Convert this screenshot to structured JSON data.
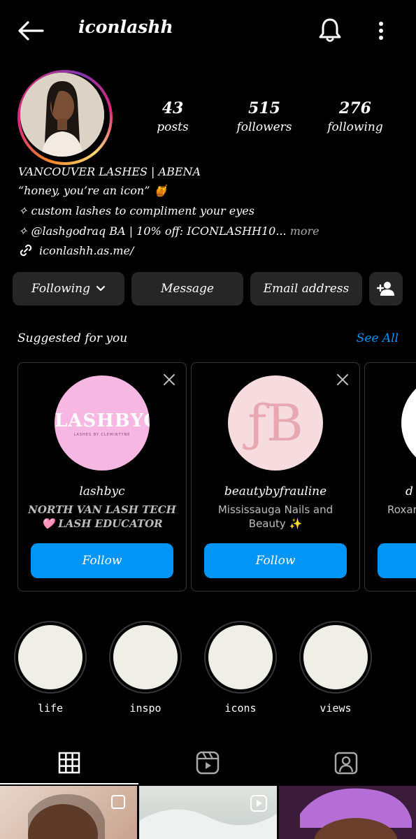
{
  "header": {
    "username": "iconlashh"
  },
  "stats": [
    {
      "num": "43",
      "label": "posts"
    },
    {
      "num": "515",
      "label": "followers"
    },
    {
      "num": "276",
      "label": "following"
    }
  ],
  "bio": {
    "name": "VANCOUVER LASHES | ABENA",
    "line1": "“honey, you’re an icon” 🍯",
    "line2": "✧ custom lashes to compliment your eyes",
    "line3": "✧ @lashgodraq BA | 10% off: ICONLASHH10...",
    "more": " more",
    "link": "iconlashh.as.me/"
  },
  "actions": {
    "following": "Following",
    "message": "Message",
    "email": "Email address"
  },
  "suggested": {
    "title": "Suggested for you",
    "see_all": "See All",
    "cards": [
      {
        "username": "lashbyc",
        "desc": "NORTH VAN LASH TECH 🩷 LASH EDUCATOR",
        "follow": "Follow",
        "logo_text": "LASHBYC",
        "logo_sub": "LASHES BY CLEMINTYNE"
      },
      {
        "username": "beautybyfrauline",
        "desc": "Mississauga Nails and Beauty ✨",
        "follow": "Follow",
        "logo_text": "ƒB"
      },
      {
        "username": "d",
        "desc": "Roxar"
      }
    ]
  },
  "highlights": [
    {
      "label": "life"
    },
    {
      "label": "inspo"
    },
    {
      "label": "icons"
    },
    {
      "label": "views"
    }
  ],
  "colors": {
    "accent": "#0095f6",
    "button_bg": "#262626",
    "bg": "#000000"
  }
}
